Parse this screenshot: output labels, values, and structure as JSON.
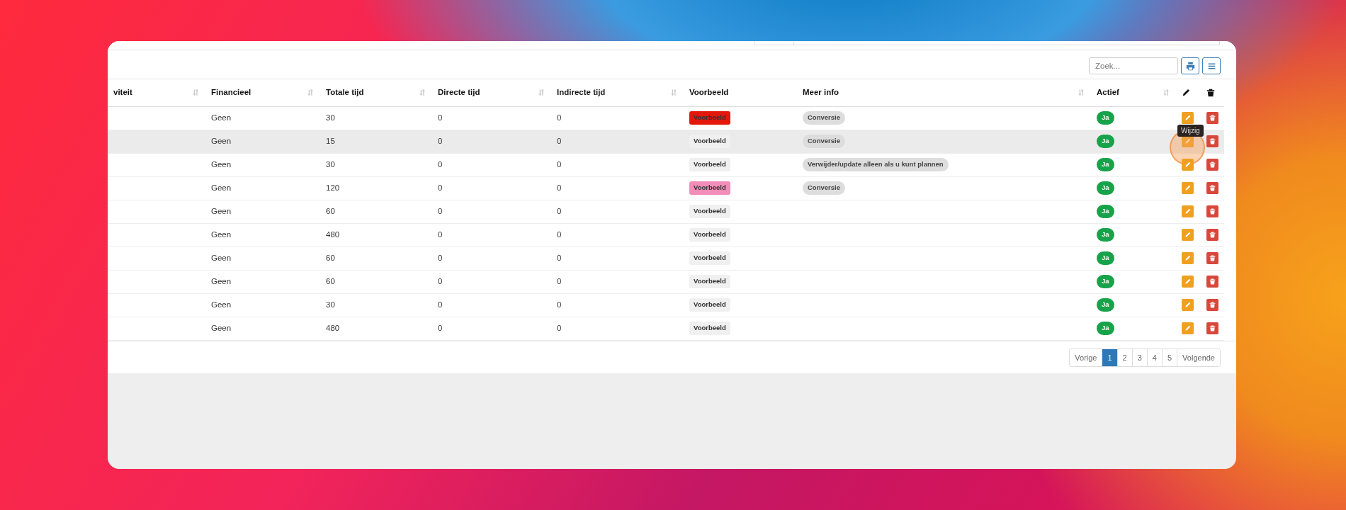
{
  "toolbar": {
    "search": {
      "placeholder": "Zoek..."
    }
  },
  "table": {
    "columns": [
      {
        "kind": "text",
        "label": "viteit",
        "sortable": true
      },
      {
        "kind": "text",
        "label": "Financieel",
        "sortable": true
      },
      {
        "kind": "text",
        "label": "Totale tijd",
        "sortable": true
      },
      {
        "kind": "text",
        "label": "Directe tijd",
        "sortable": true
      },
      {
        "kind": "text",
        "label": "Indirecte tijd",
        "sortable": true
      },
      {
        "kind": "text",
        "label": "Voorbeeld",
        "sortable": false
      },
      {
        "kind": "text",
        "label": "Meer info",
        "sortable": true
      },
      {
        "kind": "text",
        "label": "Actief",
        "sortable": true
      },
      {
        "kind": "edit"
      },
      {
        "kind": "delete"
      }
    ],
    "rows": [
      {
        "hovered": false,
        "financieel": "Geen",
        "totale_tijd": "30",
        "directe_tijd": "0",
        "indirecte_tijd": "0",
        "voorbeeld": {
          "text": "Voorbeeld",
          "color": "#e3170a"
        },
        "meer_info": "Conversie",
        "actief": "Ja"
      },
      {
        "hovered": true,
        "financieel": "Geen",
        "totale_tijd": "15",
        "directe_tijd": "0",
        "indirecte_tijd": "0",
        "voorbeeld": {
          "text": "Voorbeeld",
          "color": "#f0f0f0"
        },
        "meer_info": "Conversie",
        "actief": "Ja",
        "edit_tooltip": "Wijzig"
      },
      {
        "hovered": false,
        "financieel": "Geen",
        "totale_tijd": "30",
        "directe_tijd": "0",
        "indirecte_tijd": "0",
        "voorbeeld": {
          "text": "Voorbeeld",
          "color": "#f0f0f0"
        },
        "meer_info": "Verwijder/update alleen als u kunt plannen",
        "actief": "Ja"
      },
      {
        "hovered": false,
        "financieel": "Geen",
        "totale_tijd": "120",
        "directe_tijd": "0",
        "indirecte_tijd": "0",
        "voorbeeld": {
          "text": "Voorbeeld",
          "color": "#f28cb8"
        },
        "meer_info": "Conversie",
        "actief": "Ja"
      },
      {
        "hovered": false,
        "financieel": "Geen",
        "totale_tijd": "60",
        "directe_tijd": "0",
        "indirecte_tijd": "0",
        "voorbeeld": {
          "text": "Voorbeeld",
          "color": "#f0f0f0"
        },
        "actief": "Ja"
      },
      {
        "hovered": false,
        "financieel": "Geen",
        "totale_tijd": "480",
        "directe_tijd": "0",
        "indirecte_tijd": "0",
        "voorbeeld": {
          "text": "Voorbeeld",
          "color": "#f0f0f0"
        },
        "actief": "Ja"
      },
      {
        "hovered": false,
        "financieel": "Geen",
        "totale_tijd": "60",
        "directe_tijd": "0",
        "indirecte_tijd": "0",
        "voorbeeld": {
          "text": "Voorbeeld",
          "color": "#f0f0f0"
        },
        "actief": "Ja"
      },
      {
        "hovered": false,
        "financieel": "Geen",
        "totale_tijd": "60",
        "directe_tijd": "0",
        "indirecte_tijd": "0",
        "voorbeeld": {
          "text": "Voorbeeld",
          "color": "#f0f0f0"
        },
        "actief": "Ja"
      },
      {
        "hovered": false,
        "financieel": "Geen",
        "totale_tijd": "30",
        "directe_tijd": "0",
        "indirecte_tijd": "0",
        "voorbeeld": {
          "text": "Voorbeeld",
          "color": "#f0f0f0"
        },
        "actief": "Ja"
      },
      {
        "hovered": false,
        "financieel": "Geen",
        "totale_tijd": "480",
        "directe_tijd": "0",
        "indirecte_tijd": "0",
        "voorbeeld": {
          "text": "Voorbeeld",
          "color": "#f0f0f0"
        },
        "actief": "Ja"
      }
    ]
  },
  "pagination": {
    "previous": "Vorige",
    "pages": [
      {
        "label": "1",
        "selected": true
      },
      {
        "label": "2",
        "selected": false
      },
      {
        "label": "3",
        "selected": false
      },
      {
        "label": "4",
        "selected": false
      },
      {
        "label": "5",
        "selected": false
      }
    ],
    "next": "Volgende"
  }
}
